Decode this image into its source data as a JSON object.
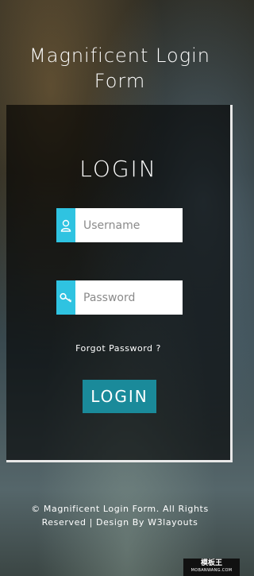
{
  "header": {
    "title": "Magnificent Login Form"
  },
  "form": {
    "title": "LOGIN",
    "username": {
      "placeholder": "Username",
      "value": ""
    },
    "password": {
      "placeholder": "Password",
      "value": ""
    },
    "forgot_label": "Forgot Password ?",
    "submit_label": "LOGIN"
  },
  "footer": {
    "text": "© Magnificent Login Form. All Rights Reserved | Design By",
    "link": "W3layouts"
  },
  "watermark": {
    "main": "模板王",
    "sub": "MOBANWANG.COM"
  },
  "colors": {
    "accent": "#2fc3e1",
    "button": "#1a8a9a"
  },
  "icons": {
    "username": "user-icon",
    "password": "key-icon"
  }
}
